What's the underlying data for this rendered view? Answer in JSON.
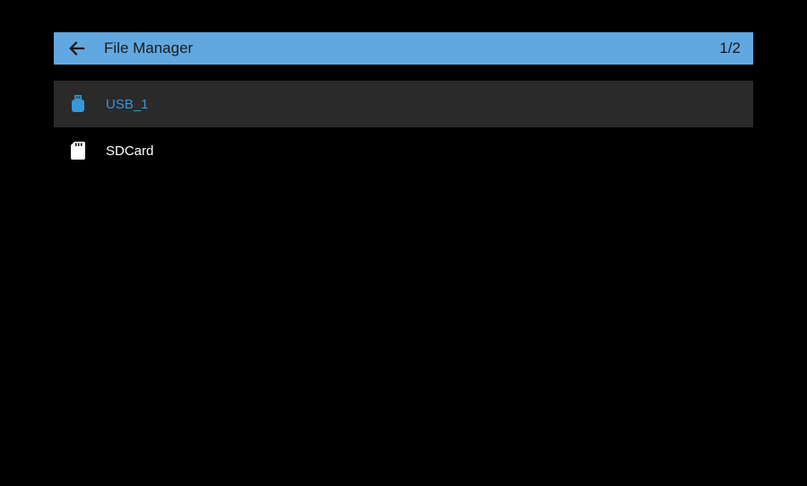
{
  "header": {
    "title": "File Manager",
    "counter": "1/2"
  },
  "storage_items": [
    {
      "label": "USB_1",
      "icon": "usb",
      "selected": true
    },
    {
      "label": "SDCard",
      "icon": "sdcard",
      "selected": false
    }
  ],
  "colors": {
    "accent": "#3698d9",
    "header_bg": "#62a8e0",
    "selected_bg": "#2a2a2a"
  }
}
